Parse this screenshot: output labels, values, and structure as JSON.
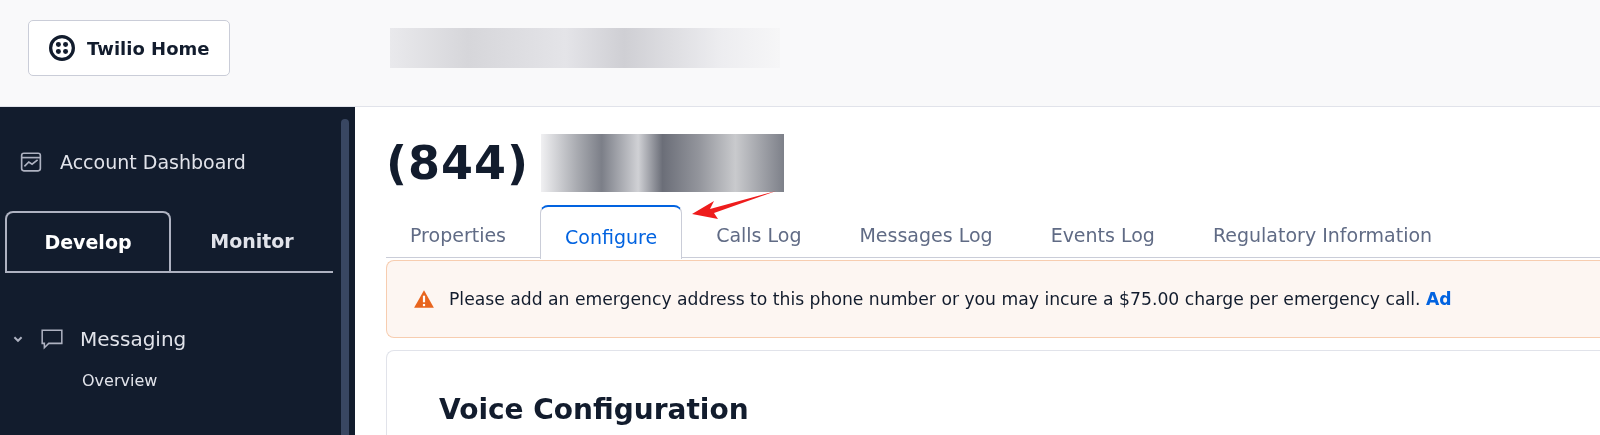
{
  "header": {
    "home_button": "Twilio Home"
  },
  "sidebar": {
    "dashboard": "Account Dashboard",
    "tabs": [
      {
        "label": "Develop",
        "selected": true
      },
      {
        "label": "Monitor",
        "selected": false
      }
    ],
    "sections": [
      {
        "label": "Messaging",
        "expanded": true,
        "children": [
          {
            "label": "Overview"
          }
        ]
      }
    ]
  },
  "page": {
    "title_prefix": "(844)",
    "tabs": [
      {
        "label": "Properties",
        "selected": false
      },
      {
        "label": "Configure",
        "selected": true
      },
      {
        "label": "Calls Log",
        "selected": false
      },
      {
        "label": "Messages Log",
        "selected": false
      },
      {
        "label": "Events Log",
        "selected": false
      },
      {
        "label": "Regulatory Information",
        "selected": false
      }
    ],
    "banner": {
      "text": "Please add an emergency address to this phone number or you may incure a $75.00 charge per emergency call.",
      "link": "Ad"
    },
    "card_title": "Voice Configuration"
  }
}
